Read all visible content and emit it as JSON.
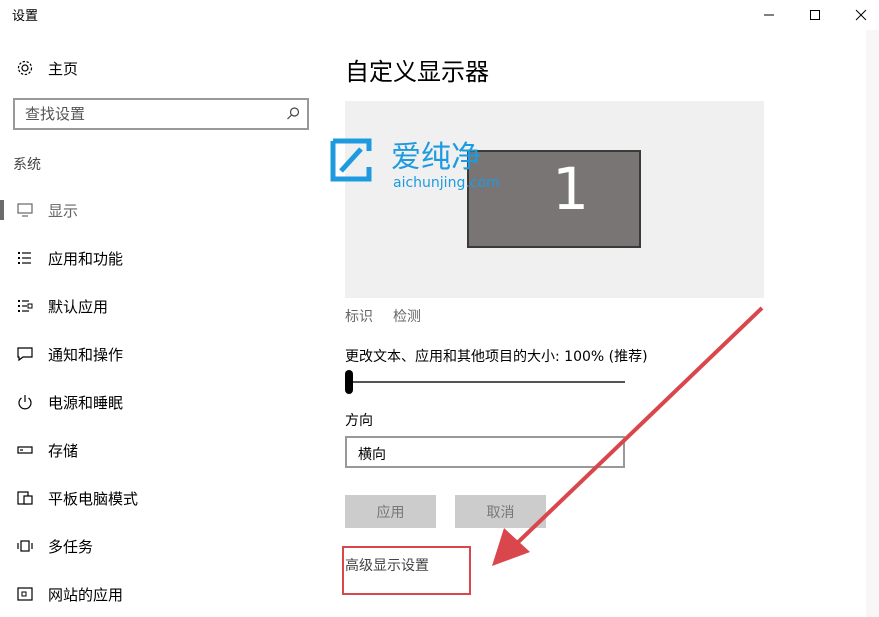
{
  "window": {
    "title": "设置"
  },
  "sidebar": {
    "home_label": "主页",
    "search_placeholder": "查找设置",
    "section_label": "系统",
    "items": [
      {
        "label": "显示",
        "icon": "monitor-icon",
        "active": true
      },
      {
        "label": "应用和功能",
        "icon": "list-icon"
      },
      {
        "label": "默认应用",
        "icon": "default-apps-icon"
      },
      {
        "label": "通知和操作",
        "icon": "notification-icon"
      },
      {
        "label": "电源和睡眠",
        "icon": "power-icon"
      },
      {
        "label": "存储",
        "icon": "storage-icon"
      },
      {
        "label": "平板电脑模式",
        "icon": "tablet-icon"
      },
      {
        "label": "多任务",
        "icon": "multitask-icon"
      },
      {
        "label": "网站的应用",
        "icon": "web-apps-icon"
      }
    ]
  },
  "main": {
    "title": "自定义显示器",
    "monitor_number": "1",
    "watermark_text": "爱纯净",
    "watermark_url": "aichunjing.com",
    "identify_label": "标识",
    "detect_label": "检测",
    "scale_label": "更改文本、应用和其他项目的大小: 100% (推荐)",
    "scale_level_percent": 0,
    "orientation_label": "方向",
    "orientation_value": "横向",
    "apply_label": "应用",
    "cancel_label": "取消",
    "advanced_link": "高级显示设置"
  },
  "colors": {
    "annotation_red": "#d9464c",
    "monitor_fill": "#7a7575",
    "watermark_blue": "#1e9be0"
  }
}
